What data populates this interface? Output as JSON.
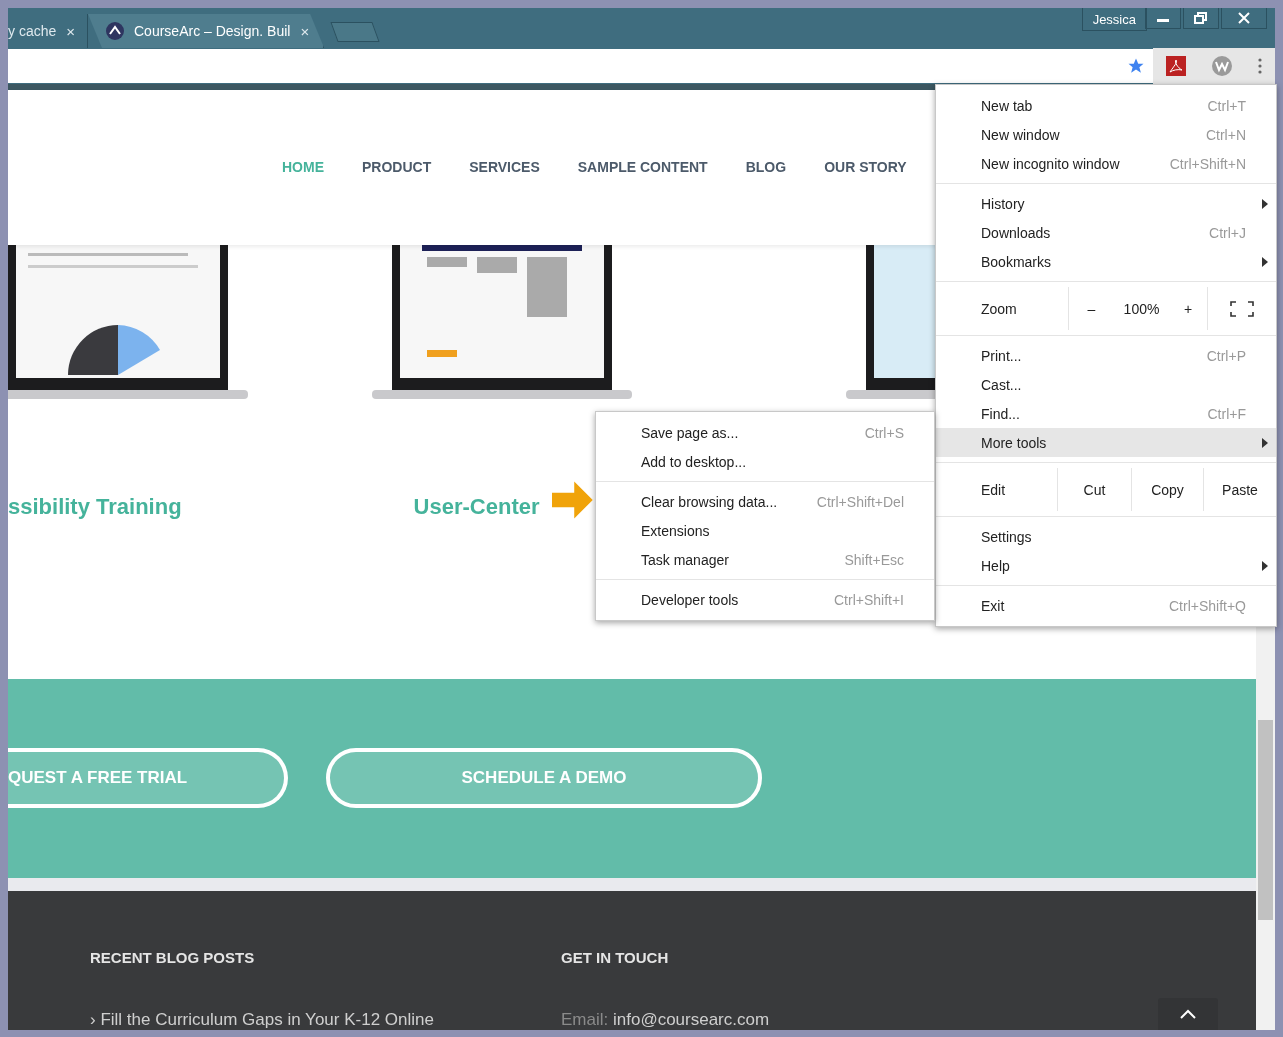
{
  "browser": {
    "tabs": [
      {
        "label": "y cache",
        "close": "×",
        "selected": false
      },
      {
        "label": "CourseArc – Design. Buil",
        "close": "×",
        "selected": true
      }
    ],
    "profile": "Jessica"
  },
  "nav": [
    {
      "label": "HOME",
      "selected": true
    },
    {
      "label": "PRODUCT",
      "selected": false
    },
    {
      "label": "SERVICES",
      "selected": false
    },
    {
      "label": "SAMPLE CONTENT",
      "selected": false
    },
    {
      "label": "BLOG",
      "selected": false
    },
    {
      "label": "OUR STORY",
      "selected": false
    }
  ],
  "showcase": [
    {
      "kind": "picture",
      "heading": "ssibility Training"
    },
    {
      "kind": "picture",
      "heading": "User-Center"
    },
    {
      "kind": "picture"
    }
  ],
  "cta_buttons": [
    "QUEST A FREE TRIAL",
    "SCHEDULE A DEMO"
  ],
  "footer": {
    "columns": [
      {
        "title": "RECENT BLOG POSTS",
        "marker": "›",
        "link": "Fill the Curriculum Gaps in Your K-12 Online"
      },
      {
        "title": "GET IN TOUCH",
        "label": "Email:",
        "value": "info@coursearc.com"
      }
    ]
  },
  "chrome_menu": [
    {
      "kind": "list",
      "items": [
        {
          "label": "New tab",
          "shortcut": "Ctrl+T",
          "submenu": false,
          "selected": false
        },
        {
          "label": "New window",
          "shortcut": "Ctrl+N",
          "submenu": false,
          "selected": false
        },
        {
          "label": "New incognito window",
          "shortcut": "Ctrl+Shift+N",
          "submenu": false,
          "selected": false
        }
      ]
    },
    {
      "kind": "list",
      "items": [
        {
          "label": "History",
          "submenu": true,
          "selected": false
        },
        {
          "label": "Downloads",
          "shortcut": "Ctrl+J",
          "submenu": false,
          "selected": false
        },
        {
          "label": "Bookmarks",
          "submenu": true,
          "selected": false
        }
      ]
    },
    {
      "kind": "zoom",
      "label": "Zoom",
      "minus": "–",
      "value": "100%",
      "plus": "+"
    },
    {
      "kind": "list",
      "items": [
        {
          "label": "Print...",
          "shortcut": "Ctrl+P",
          "submenu": false,
          "selected": false
        },
        {
          "label": "Cast...",
          "submenu": false,
          "selected": false
        },
        {
          "label": "Find...",
          "shortcut": "Ctrl+F",
          "submenu": false,
          "selected": false
        },
        {
          "label": "More tools",
          "submenu": true,
          "selected": true
        }
      ]
    },
    {
      "kind": "edit",
      "label": "Edit",
      "buttons": [
        "Cut",
        "Copy",
        "Paste"
      ]
    },
    {
      "kind": "list",
      "items": [
        {
          "label": "Settings",
          "submenu": false,
          "selected": false
        },
        {
          "label": "Help",
          "submenu": true,
          "selected": false
        }
      ]
    },
    {
      "kind": "list",
      "items": [
        {
          "label": "Exit",
          "shortcut": "Ctrl+Shift+Q",
          "submenu": false,
          "selected": false
        }
      ]
    }
  ],
  "more_tools_menu": [
    [
      {
        "label": "Save page as...",
        "shortcut": "Ctrl+S"
      },
      {
        "label": "Add to desktop..."
      }
    ],
    [
      {
        "label": "Clear browsing data...",
        "shortcut": "Ctrl+Shift+Del"
      },
      {
        "label": "Extensions"
      },
      {
        "label": "Task manager",
        "shortcut": "Shift+Esc"
      }
    ],
    [
      {
        "label": "Developer tools",
        "shortcut": "Ctrl+Shift+I"
      }
    ]
  ]
}
